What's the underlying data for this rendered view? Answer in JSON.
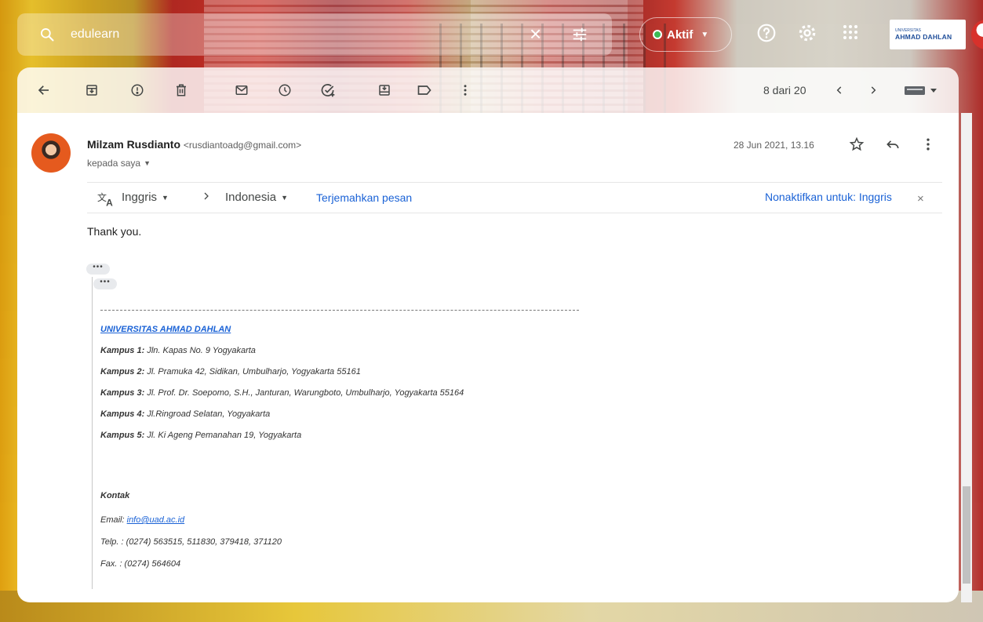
{
  "search": {
    "value": "edulearn"
  },
  "status": {
    "label": "Aktif",
    "color": "#3cba54"
  },
  "brand": {
    "top": "UNIVERSITAS",
    "name": "AHMAD DAHLAN"
  },
  "toolbar": {
    "count": "8 dari 20"
  },
  "message": {
    "sender_name": "Milzam Rusdianto",
    "sender_email": "<rusdiantoadg@gmail.com>",
    "to": "kepada saya",
    "date": "28 Jun 2021, 13.16",
    "body": "Thank you."
  },
  "translate": {
    "from_lang": "Inggris",
    "to_lang": "Indonesia",
    "action": "Terjemahkan pesan",
    "disable": "Nonaktifkan untuk: Inggris"
  },
  "ellipsis": "•••",
  "signature": {
    "university": "UNIVERSITAS AHMAD DAHLAN",
    "campuses": [
      {
        "label": "Kampus 1:",
        "address": "Jln. Kapas No. 9 Yogyakarta"
      },
      {
        "label": "Kampus 2:",
        "address": "Jl. Pramuka 42, Sidikan, Umbulharjo, Yogyakarta 55161"
      },
      {
        "label": "Kampus 3:",
        "address": "Jl. Prof. Dr. Soepomo, S.H., Janturan, Warungboto, Umbulharjo, Yogyakarta 55164"
      },
      {
        "label": "Kampus 4:",
        "address": "Jl.Ringroad Selatan, Yogyakarta"
      },
      {
        "label": "Kampus 5:",
        "address": "Jl. Ki Ageng Pemanahan 19, Yogyakarta"
      }
    ],
    "contact_heading": "Kontak",
    "email_label": "Email:",
    "email": "info@uad.ac.id",
    "phone": "Telp. : (0274) 563515, 511830, 379418, 371120",
    "fax": "Fax. : (0274) 564604"
  }
}
